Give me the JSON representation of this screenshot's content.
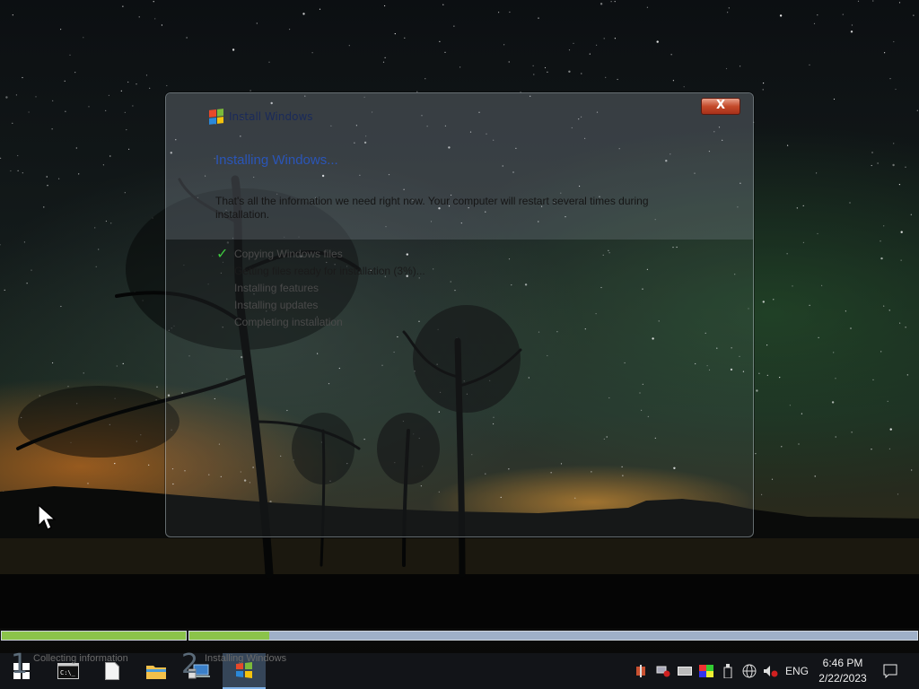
{
  "window": {
    "title": "Install Windows",
    "close_label": "X",
    "heading": "Installing Windows...",
    "info": "That's all the information we need right now. Your computer will restart several times during installation.",
    "steps": [
      {
        "label": "Copying Windows files",
        "done": true
      },
      {
        "label": "Getting files ready for installation (3%)...",
        "done": false
      },
      {
        "label": "Installing features",
        "done": false
      },
      {
        "label": "Installing updates",
        "done": false
      },
      {
        "label": "Completing installation",
        "done": false
      }
    ]
  },
  "setup_progress": {
    "stage1": {
      "number": "1",
      "label": "Collecting information",
      "progress": 1.0
    },
    "stage2": {
      "number": "2",
      "label": "Installing Windows",
      "progress": 0.11
    }
  },
  "taskbar": {
    "items": [
      "start-icon",
      "command-prompt-icon",
      "document-icon",
      "file-explorer-icon",
      "network-setup-icon",
      "windows-setup-icon"
    ],
    "tray": {
      "language": "ENG",
      "time": "6:46 PM",
      "date": "2/22/2023"
    }
  },
  "colors": {
    "accent": "#2a55b8",
    "progress_fill": "#8bc34a",
    "progress_track": "#9fb0c8",
    "check": "#3fc83f"
  }
}
